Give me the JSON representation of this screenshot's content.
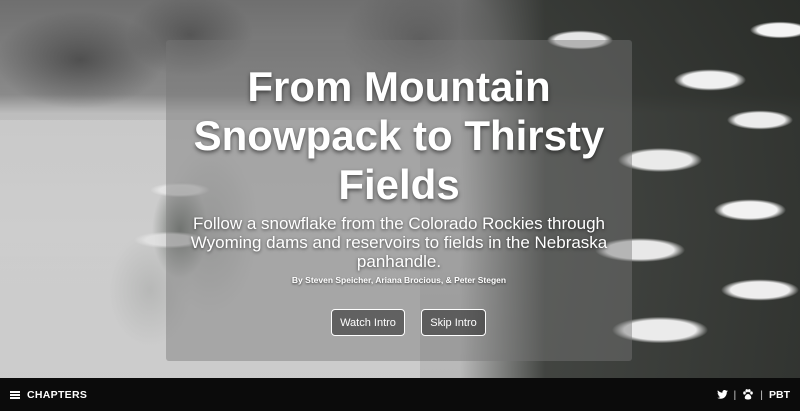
{
  "hero": {
    "title": "From Mountain Snowpack to Thirsty Fields",
    "subtitle": "Follow a snowflake from the Colorado Rockies through Wyoming dams and reservoirs to fields in the Nebraska panhandle.",
    "byline": "By Steven Speicher, Ariana Brocious, & Peter Stegen",
    "watch_label": "Watch Intro",
    "skip_label": "Skip Intro"
  },
  "bottom_bar": {
    "chapters_label": "CHAPTERS",
    "chapters_icon": "hamburger-menu-icon",
    "twitter_icon": "twitter-bird-icon",
    "separator": "|",
    "paw_icon": "paw-print-icon",
    "pbt_label": "PBT"
  },
  "colors": {
    "bar_background": "#0b0b0b",
    "text": "#ffffff",
    "panel_overlay": "rgba(120,120,120,0.45)"
  }
}
